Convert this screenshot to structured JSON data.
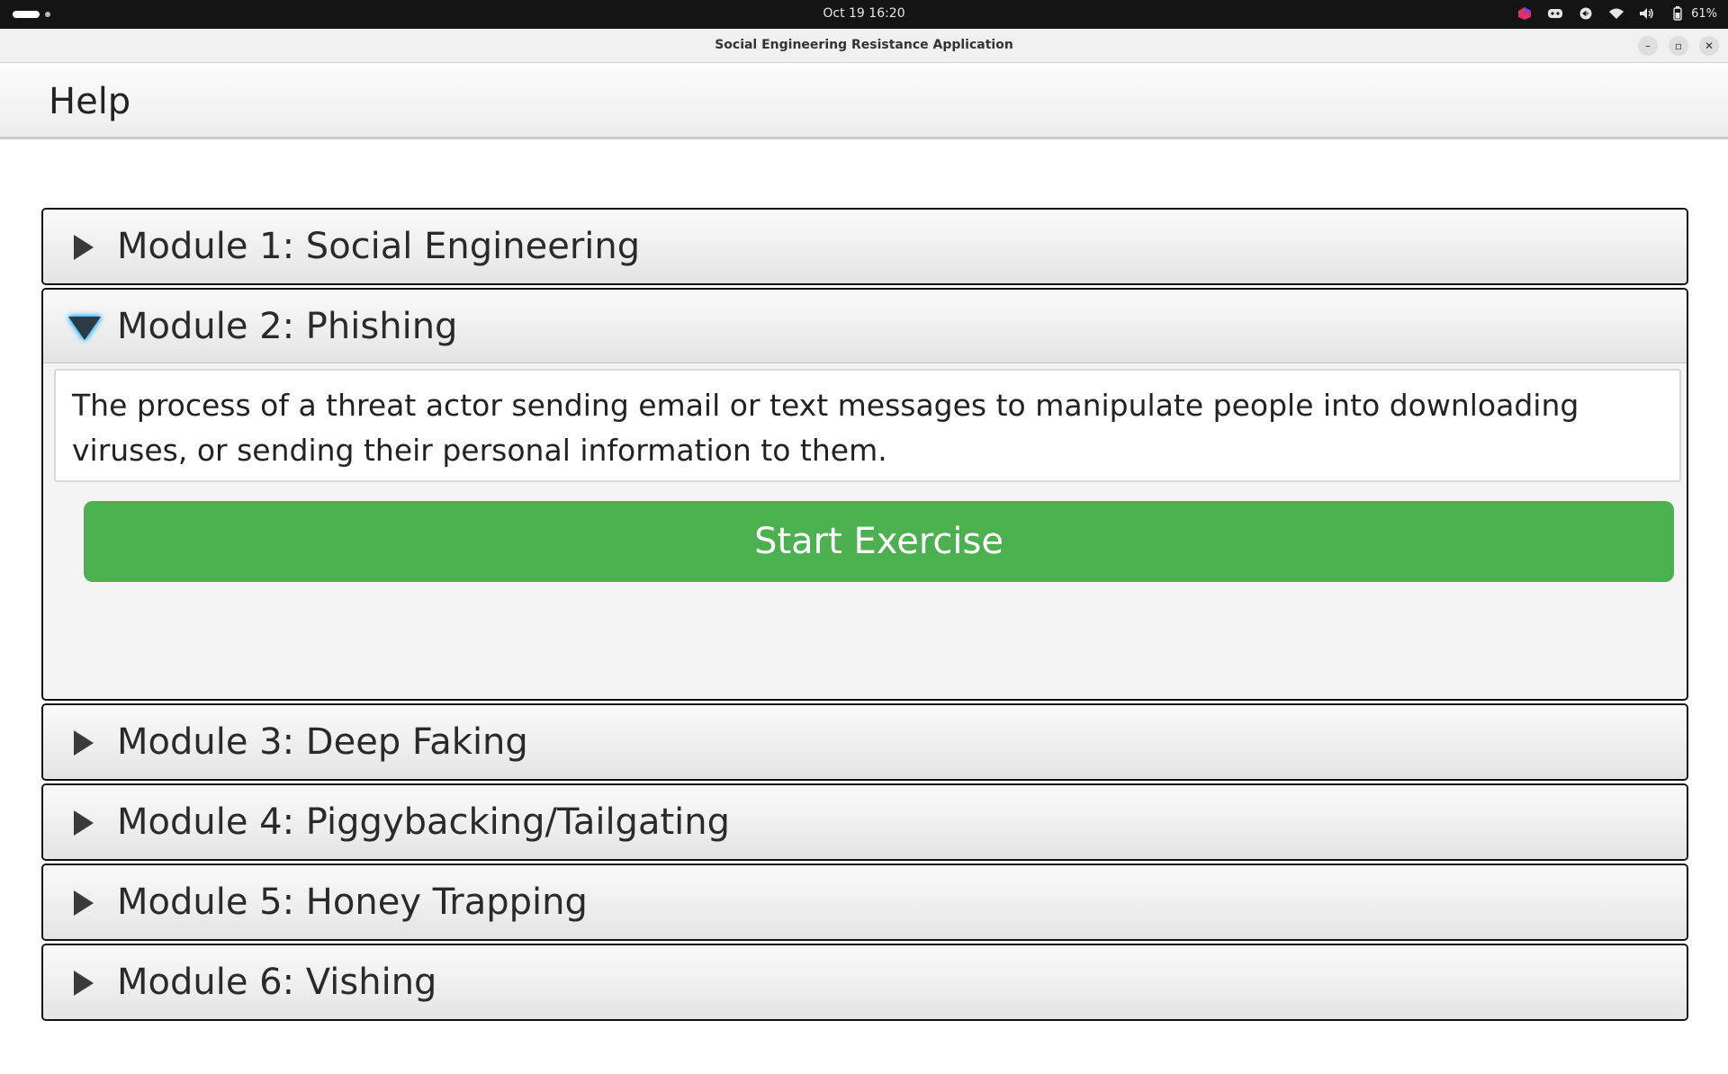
{
  "system_bar": {
    "clock": "Oct 19  16:20",
    "battery": "61%",
    "icons": [
      "app-indicator-icon",
      "discord-icon",
      "sync-icon",
      "wifi-icon",
      "volume-icon",
      "battery-icon"
    ]
  },
  "window": {
    "title": "Social Engineering Resistance Application",
    "minimize": "–",
    "maximize": "▫",
    "close": "✕"
  },
  "header": {
    "title": "Help"
  },
  "modules": [
    {
      "label": "Module 1: Social Engineering",
      "expanded": false
    },
    {
      "label": "Module 2: Phishing",
      "expanded": true,
      "description": "The process of a threat actor sending email or text messages to manipulate people into downloading viruses, or sending their personal information to them.",
      "button_label": "Start Exercise"
    },
    {
      "label": "Module 3: Deep Faking",
      "expanded": false
    },
    {
      "label": "Module 4: Piggybacking/Tailgating",
      "expanded": false
    },
    {
      "label": "Module 5: Honey Trapping",
      "expanded": false
    },
    {
      "label": "Module 6: Vishing",
      "expanded": false
    }
  ],
  "colors": {
    "accent_button": "#4caf50",
    "expand_glow": "#27b4ff"
  }
}
